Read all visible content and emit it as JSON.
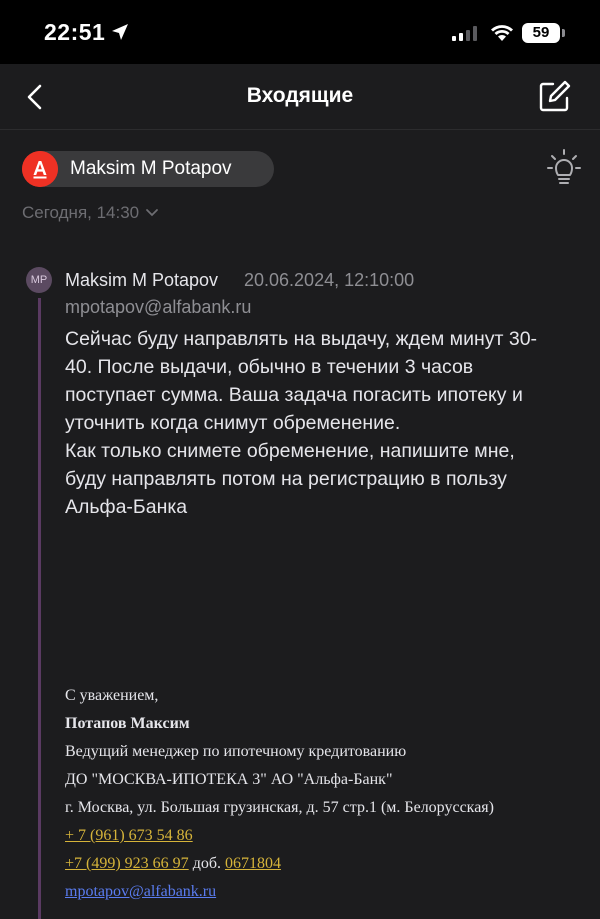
{
  "status_bar": {
    "time": "22:51",
    "battery": "59"
  },
  "nav": {
    "title": "Входящие"
  },
  "header": {
    "sender_name": "Maksim M Potapov",
    "date": "Сегодня, 14:30",
    "brand_color": "#ef3124"
  },
  "quoted": {
    "avatar_initials": "MP",
    "name": "Maksim M Potapov",
    "datetime": "20.06.2024, 12:10:00",
    "email": "mpotapov@alfabank.ru",
    "body_lines": [
      "Сейчас буду направлять на выдачу, ждем минут 30-",
      "40. После выдачи, обычно в течении 3 часов",
      "поступает сумма. Ваша задача погасить ипотеку и",
      "уточнить когда снимут обременение.",
      "Как только снимете обременение, напишите мне,",
      "буду направлять потом на регистрацию в пользу",
      "Альфа-Банка"
    ]
  },
  "signature": {
    "greeting": "С уважением,",
    "name": "Потапов Максим",
    "position": "Ведущий менеджер по ипотечному кредитованию",
    "office": "ДО \"МОСКВА-ИПОТЕКА 3\" АО \"Альфа-Банк\"",
    "address": "г. Москва, ул. Большая грузинская, д. 57 стр.1 (м. Белорусская)",
    "phone1": "+ 7 (961) 673 54 86",
    "phone2": "+7 (499) 923 66 97",
    "ext_label": " доб. ",
    "ext": "0671804",
    "email": "mpotapov@alfabank.ru"
  }
}
